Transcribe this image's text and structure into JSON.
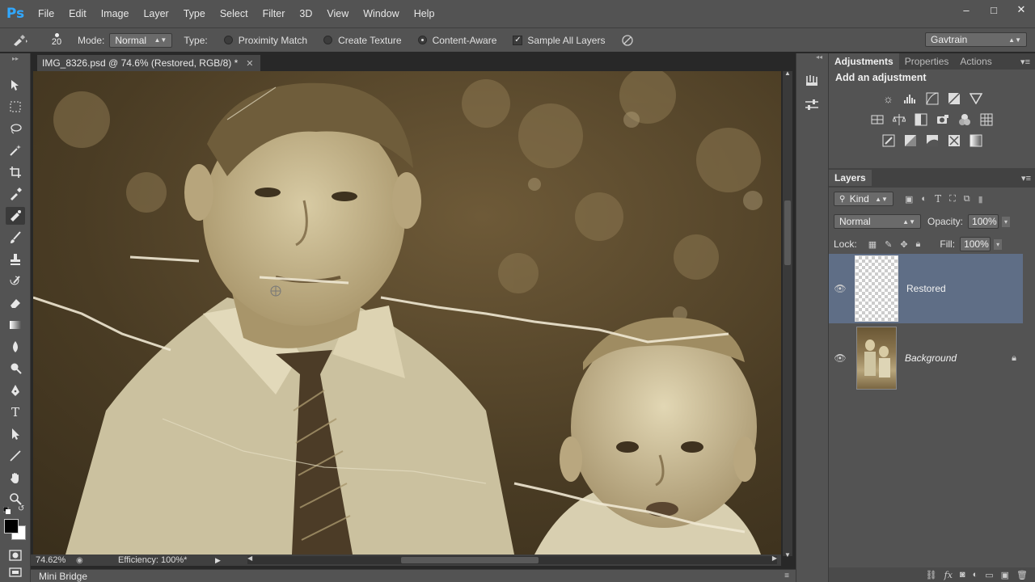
{
  "app": {
    "logo": "Ps"
  },
  "menu": [
    "File",
    "Edit",
    "Image",
    "Layer",
    "Type",
    "Select",
    "Filter",
    "3D",
    "View",
    "Window",
    "Help"
  ],
  "window_controls": {
    "minimize": "–",
    "maximize": "□",
    "close": "✕"
  },
  "options": {
    "brush_size": "20",
    "mode_label": "Mode:",
    "mode_value": "Normal",
    "type_label": "Type:",
    "proximity": "Proximity Match",
    "create_texture": "Create Texture",
    "content_aware": "Content-Aware",
    "sample_all": "Sample All Layers",
    "workspace": "Gavtrain"
  },
  "document": {
    "tab_title": "IMG_8326.psd @ 74.6% (Restored, RGB/8) *",
    "zoom": "74.62%",
    "efficiency": "Efficiency: 100%*"
  },
  "minibridge": "Mini Bridge",
  "panels": {
    "tabs": [
      "Adjustments",
      "Properties",
      "Actions"
    ],
    "adj_title": "Add an adjustment",
    "layers_tab": "Layers",
    "kind": "Kind",
    "blend": "Normal",
    "opacity_label": "Opacity:",
    "opacity": "100%",
    "lock_label": "Lock:",
    "fill_label": "Fill:",
    "fill": "100%",
    "layers": [
      {
        "name": "Restored",
        "selected": true
      },
      {
        "name": "Background",
        "selected": false
      }
    ]
  },
  "icons": {
    "brightness": "brightness-icon",
    "levels": "levels-icon",
    "curves": "curves-icon",
    "exposure": "exposure-icon",
    "vibrance": "vibrance-icon"
  },
  "colors": {
    "selection": "#5f6e86",
    "panel": "#535353",
    "ps_blue": "#31a8ff"
  }
}
